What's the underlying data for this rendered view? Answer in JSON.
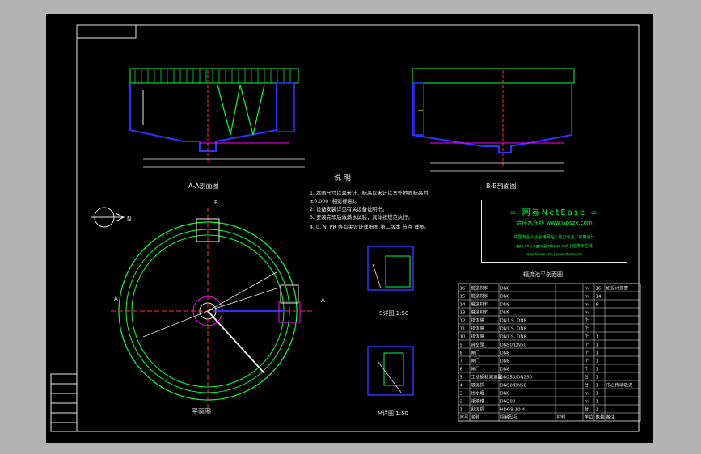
{
  "section_aa": "A-A剖面图",
  "section_bb": "B-B剖面图",
  "plan": "平面图",
  "notes": {
    "title": "说    明",
    "lines": [
      "1. 本图尺寸以毫米计，标高以米计以室外地面标高为",
      "±0.000 (相对标高)。",
      "2. 设备安装详见有关设备说明书。",
      "3. 安装完毕后做满水试验，具体按规范执行。",
      "4. 0. N. PR 等有关设计详细图 第二版本 节点 详图。"
    ]
  },
  "detail_s": "S详图 1:50",
  "detail_m": "M详图 1:50",
  "banner": {
    "line1": "=  网易NetEase  =",
    "line2": "给排水在线   www.Gpszx.com",
    "line3": "中国专业人士必用网站 | 助力专业，实用设计",
    "line4": "gps.cn | kgps@ntease.net | 给排水在线",
    "line5": "www.Gpszx.com | www.ntease.net"
  },
  "table_title": "辐流池平剖面图",
  "table": {
    "header": [
      "序号",
      "名称",
      "规格型号",
      "材料",
      "单位",
      "数量",
      "备注"
    ],
    "rows": [
      [
        "16",
        "管道材料",
        "DN8",
        "",
        "m",
        "16",
        "如设计变更"
      ],
      [
        "15",
        "管道材料",
        "DN8",
        "",
        "m",
        "14",
        ""
      ],
      [
        "14",
        "管道材料",
        "DN8",
        "",
        "m",
        "6",
        ""
      ],
      [
        "13",
        "管道材料",
        "DN8",
        "",
        "m",
        "",
        ""
      ],
      [
        "12",
        "排泥管",
        "DN1.9, DN8",
        "",
        "个",
        "",
        ""
      ],
      [
        "11",
        "排泥管",
        "DN1.9, DN8",
        "",
        "个",
        "",
        ""
      ],
      [
        "10",
        "排泥管",
        "DN1.9, DN8",
        "",
        "个",
        "1",
        ""
      ],
      [
        "9",
        "真空泵",
        "DN50/DN50",
        "",
        "个",
        "1",
        ""
      ],
      [
        "8",
        "闸门",
        "DN8",
        "",
        "个",
        "1",
        ""
      ],
      [
        "7",
        "闸门",
        "DN8",
        "",
        "个",
        "1",
        ""
      ],
      [
        "6",
        "闸门",
        "DN8",
        "",
        "个",
        "1",
        ""
      ],
      [
        "5",
        "工业蜗轮减速器",
        "DN250/DN250",
        "",
        "台",
        "1",
        ""
      ],
      [
        "4",
        "吸泥机",
        "DN50/DN50",
        "",
        "台",
        "1",
        "中心传动吸泥"
      ],
      [
        "3",
        "出水堰",
        "DN8",
        "",
        "m",
        "1",
        ""
      ],
      [
        "2",
        "浮渣槽",
        "DN300",
        "",
        "m",
        "1",
        ""
      ],
      [
        "1",
        "刮泥机",
        "HDG8-10-4",
        "",
        "台",
        "1",
        ""
      ]
    ]
  },
  "title_block": [
    "",
    ""
  ],
  "compass": "N",
  "labels": {
    "A": "A",
    "B": "B"
  }
}
